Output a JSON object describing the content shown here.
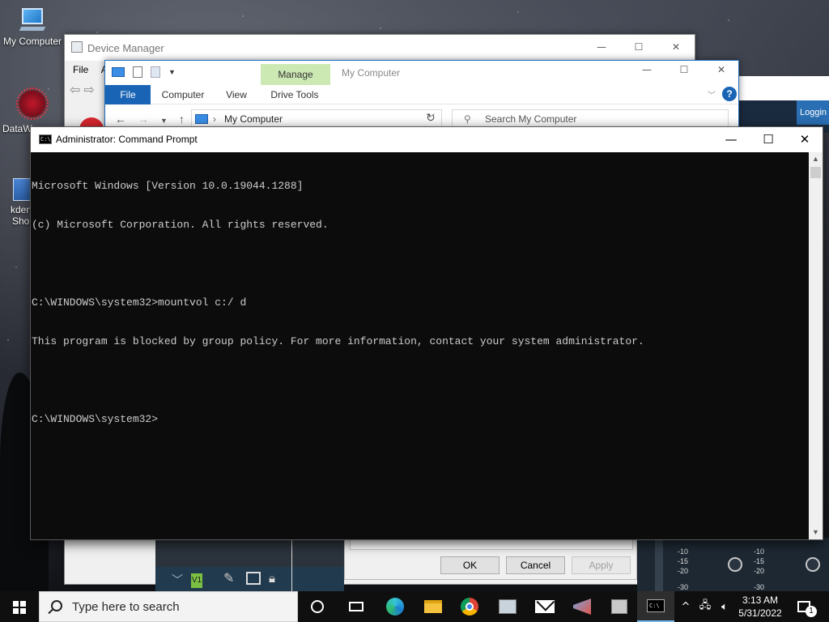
{
  "desktop": {
    "icons": [
      {
        "label": "My Computer"
      },
      {
        "label": "DataW"
      },
      {
        "label": "kden"
      },
      {
        "label": "Shor"
      }
    ]
  },
  "device_manager": {
    "title": "Device Manager",
    "menu": [
      "File",
      "A"
    ]
  },
  "explorer": {
    "title": "My Computer",
    "contextual_tab": "Manage",
    "ribbon_tabs": [
      "File",
      "Computer",
      "View",
      "Drive Tools"
    ],
    "address": "My Computer",
    "search_placeholder": "Search My Computer"
  },
  "background_window": {
    "logging_label": "Loggin"
  },
  "dialog": {
    "ok": "OK",
    "cancel": "Cancel",
    "apply": "Apply"
  },
  "editor": {
    "track_label": "V1"
  },
  "mixer": {
    "left_scale": [
      "-10",
      "-15",
      "-20",
      "-30"
    ],
    "right_scale": [
      "-10",
      "-15",
      "-20",
      "-30"
    ]
  },
  "cmd": {
    "title": "Administrator: Command Prompt",
    "lines": [
      "Microsoft Windows [Version 10.0.19044.1288]",
      "(c) Microsoft Corporation. All rights reserved.",
      "",
      "C:\\WINDOWS\\system32>mountvol c:/ d",
      "This program is blocked by group policy. For more information, contact your system administrator.",
      "",
      "C:\\WINDOWS\\system32>"
    ]
  },
  "taskbar": {
    "search_placeholder": "Type here to search",
    "pinned": [
      "cortana-icon",
      "task-view-icon",
      "edge-icon",
      "file-explorer-icon",
      "chrome-icon",
      "device-manager-icon",
      "mail-icon",
      "visual-studio-icon",
      "package-icon",
      "command-prompt-icon"
    ],
    "time": "3:13 AM",
    "date": "5/31/2022",
    "notification_count": "1"
  }
}
